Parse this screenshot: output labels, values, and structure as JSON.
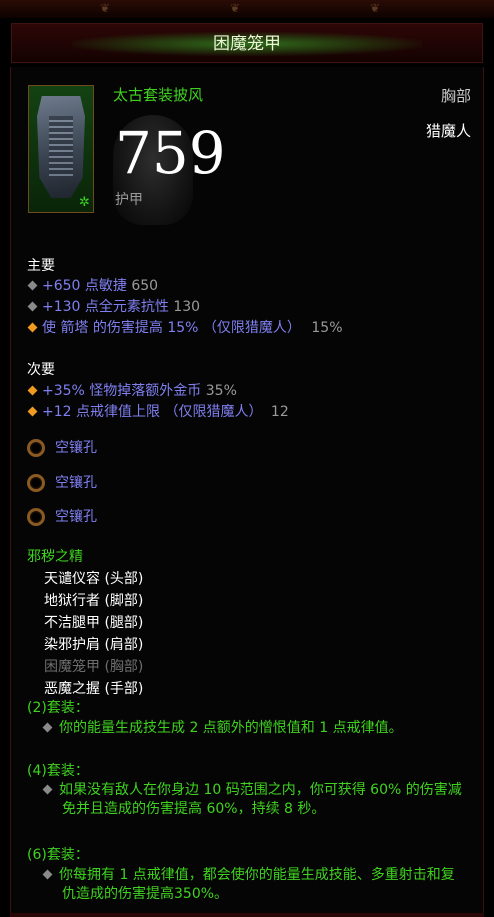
{
  "item": {
    "title": "困魔笼甲",
    "name": "太古套装披风",
    "slot": "胸部",
    "class": "猎魔人",
    "armor": "759",
    "armor_label": "护甲"
  },
  "primary": {
    "heading": "主要",
    "stats": [
      {
        "text": "+650 点敏捷",
        "value": "650",
        "bullet": "grey"
      },
      {
        "text": "+130 点全元素抗性",
        "value": "130",
        "bullet": "grey"
      },
      {
        "text": "使 箭塔 的伤害提高 15% （仅限猎魔人）",
        "value": "15%",
        "bullet": "orange"
      }
    ]
  },
  "secondary": {
    "heading": "次要",
    "stats": [
      {
        "text": "+35% 怪物掉落额外金币",
        "value": "35%",
        "bullet": "orange"
      },
      {
        "text": "+12 点戒律值上限 （仅限猎魔人）",
        "value": "12",
        "bullet": "orange"
      }
    ]
  },
  "sockets": [
    "空镶孔",
    "空镶孔",
    "空镶孔"
  ],
  "set": {
    "name": "邪秽之精",
    "pieces": [
      {
        "text": "天谴仪容 (头部)",
        "equipped": true
      },
      {
        "text": "地狱行者 (脚部)",
        "equipped": true
      },
      {
        "text": "不洁腿甲 (腿部)",
        "equipped": true
      },
      {
        "text": "染邪护肩 (肩部)",
        "equipped": true
      },
      {
        "text": "困魔笼甲 (胸部)",
        "equipped": false
      },
      {
        "text": "恶魔之握 (手部)",
        "equipped": true
      }
    ],
    "bonuses": [
      {
        "label": "(2)套装：",
        "text": "你的能量生成技生成 2 点额外的憎恨值和 1 点戒律值。"
      },
      {
        "label": "(4)套装：",
        "text": "如果没有敌人在你身边 10 码范围之内，你可获得 60% 的伤害减免并且造成的伤害提高 60%，持续 8 秒。"
      },
      {
        "label": "(6)套装：",
        "text": "你每拥有 1 点戒律值，都会使你的能量生成技能、多重射击和复仇造成的伤害提高350%。"
      }
    ]
  },
  "colors": {
    "set_green": "#3fd21f",
    "magic_blue": "#7f7ff0",
    "legendary_orange": "#f09a20",
    "background": "#050505"
  },
  "icons": {
    "item": "chest-armor-icon",
    "ancient": "ancient-star-icon",
    "socket": "empty-socket-icon"
  }
}
